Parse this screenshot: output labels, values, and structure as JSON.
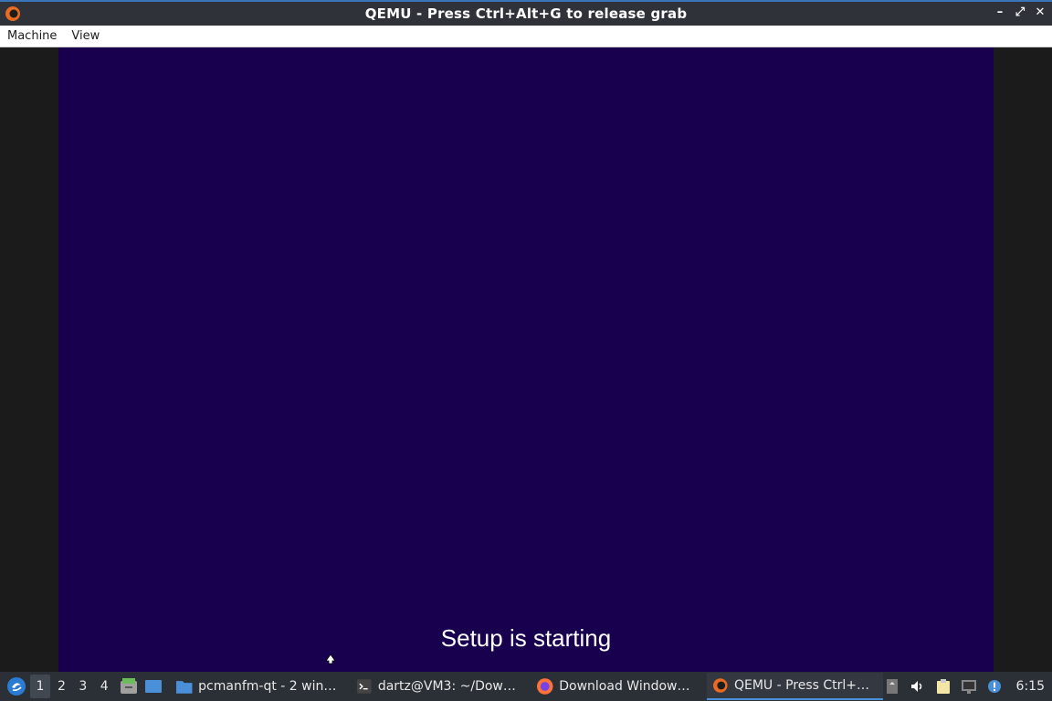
{
  "window": {
    "title": "QEMU - Press Ctrl+Alt+G to release grab",
    "controls": {
      "minimize": "–",
      "maximize": "⤢",
      "close": "✕"
    }
  },
  "menubar": {
    "items": [
      "Machine",
      "View"
    ]
  },
  "guest": {
    "status_text": "Setup is starting",
    "background_color": "#19004f"
  },
  "taskbar": {
    "workspaces": [
      "1",
      "2",
      "3",
      "4"
    ],
    "tasks": [
      {
        "label": "pcmanfm-qt - 2 wind...",
        "icon": "folder-icon"
      },
      {
        "label": "dartz@VM3: ~/Down...",
        "icon": "terminal-icon"
      },
      {
        "label": "Download Windows ...",
        "icon": "firefox-icon"
      },
      {
        "label": "QEMU - Press Ctrl+Al...",
        "icon": "qemu-icon",
        "active": true
      }
    ],
    "clock": "6:15"
  },
  "colors": {
    "titlebar": "#2f3238",
    "taskbar": "#2b2f36",
    "accent": "#4a90d9"
  }
}
